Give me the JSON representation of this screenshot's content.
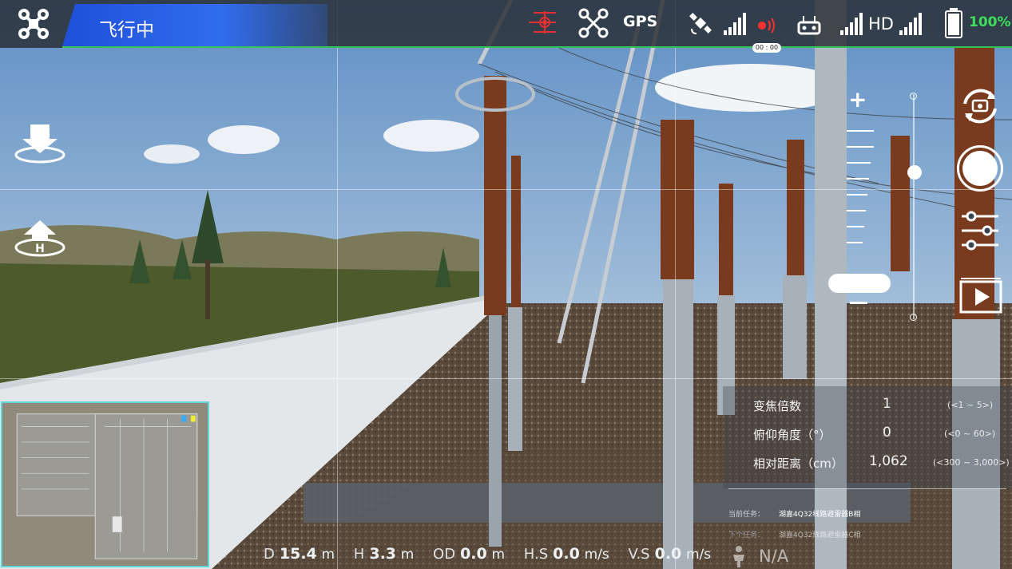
{
  "status_bar": {
    "flight_status": "飞行中",
    "gps_label": "GPS",
    "hd_label": "HD",
    "battery_percent": "100%",
    "record_timer": "00 : 00",
    "accent_color": "#2f6df0",
    "battery_color": "#3ce05a"
  },
  "icons": [
    "drone-logo-icon",
    "obstacle-sensor-icon",
    "drone-status-icon",
    "satellite-icon",
    "signal-bars-icon",
    "recording-icon",
    "remote-controller-icon",
    "hd-signal-icon",
    "battery-icon",
    "download-icon",
    "return-home-icon",
    "camera-switch-icon",
    "camera-settings-icon",
    "playback-icon"
  ],
  "info_panel": {
    "rows": [
      {
        "label": "变焦倍数",
        "value": "1",
        "range": "(<1 ~ 5>)"
      },
      {
        "label": "俯仰角度（°）",
        "value": "0",
        "range": "(<0 ~ 60>)"
      },
      {
        "label": "相对距离（cm）",
        "value": "1,062",
        "range": "(<300 ~ 3,000>)"
      }
    ],
    "current_task_label": "当前任务：",
    "current_task": "湖嘉4Q32线路避雷器B相",
    "next_task_label": "下个任务：",
    "next_task": "湖嘉4Q32线路避雷器C相"
  },
  "telemetry": {
    "d_label": "D",
    "d_value": "15.4",
    "d_unit": "m",
    "h_label": "H",
    "h_value": "3.3",
    "h_unit": "m",
    "od_label": "OD",
    "od_value": "0.0",
    "od_unit": "m",
    "hs_label": "H.S",
    "hs_value": "0.0",
    "hs_unit": "m/s",
    "vs_label": "V.S",
    "vs_value": "0.0",
    "vs_unit": "m/s",
    "na_label": "N/A"
  },
  "zoom": {
    "level": 1,
    "min": 1,
    "max": 5
  }
}
